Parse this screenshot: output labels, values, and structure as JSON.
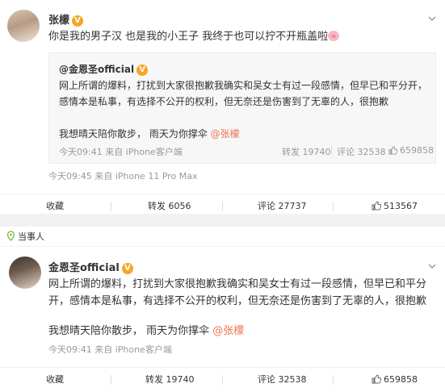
{
  "post1": {
    "author": "张檬",
    "text": "你是我的男子汉 也是我的小王子 我终于也可以拧不开瓶盖啦",
    "quote": {
      "author": "@金恩圣official",
      "text": "网上所谓的爆料，打扰到大家很抱歉我确实和吴女士有过一段感情，但早已和平分开，感情本是私事，有选择不公开的权利，但无奈还是伤害到了无辜的人，很抱歉",
      "text2_prefix": "我想晴天陪你散步，  雨天为你撑伞 ",
      "mention": "@张檬",
      "time": "今天09:41 来自 iPhone客户端",
      "repost": "转发 19740",
      "comment": "评论 32538",
      "like": "659858"
    },
    "time": "今天09:45 来自 iPhone 11 Pro Max",
    "actions": {
      "collect": "收藏",
      "repost": "转发 6056",
      "comment": "评论 27737",
      "like": "513567"
    }
  },
  "tag": "当事人",
  "post2": {
    "author": "金恩圣official",
    "text": "网上所谓的爆料，打扰到大家很抱歉我确实和吴女士有过一段感情，但早已和平分开，感情本是私事，有选择不公开的权利，但无奈还是伤害到了无辜的人，很抱歉",
    "text2_prefix": "我想晴天陪你散步，  雨天为你撑伞 ",
    "mention": "@张檬",
    "time": "今天09:41 来自 iPhone客户端",
    "actions": {
      "collect": "收藏",
      "repost": "转发 19740",
      "comment": "评论 32538",
      "like": "659858"
    }
  },
  "colors": {
    "mention": "#eb7350",
    "verified": "#f5a623",
    "tag_icon": "#7cbf4a"
  }
}
